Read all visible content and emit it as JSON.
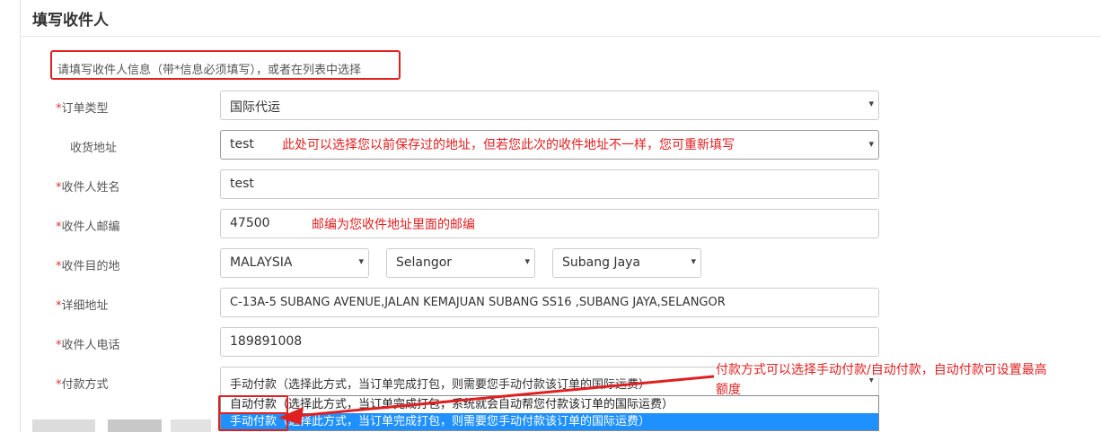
{
  "panel": {
    "title": "填写收件人"
  },
  "notice": "请填写收件人信息（带*信息必须填写），或者在列表中选择",
  "required_mark": "*",
  "fields": {
    "order_type": {
      "label": "订单类型",
      "value": "国际代运"
    },
    "address": {
      "label": "收货地址",
      "value": "test"
    },
    "name": {
      "label": "收件人姓名",
      "value": "test"
    },
    "postcode": {
      "label": "收件人邮编",
      "value": "47500"
    },
    "destination": {
      "label": "收件目的地",
      "country": "MALAYSIA",
      "state": "Selangor",
      "city": "Subang Jaya"
    },
    "detail": {
      "label": "详细地址",
      "value": "C-13A-5 SUBANG AVENUE,JALAN KEMAJUAN SUBANG SS16 ,SUBANG JAYA,SELANGOR"
    },
    "phone": {
      "label": "收件人电话",
      "value": "189891008"
    },
    "payment": {
      "label": "付款方式",
      "value": "手动付款（选择此方式，当订单完成打包，则需要您手动付款该订单的国际运费）",
      "options": [
        "自动付款（选择此方式，当订单完成打包，系统就会自动帮您付款该订单的国际运费）",
        "手动付款（选择此方式，当订单完成打包，则需要您手动付款该订单的国际运费）"
      ]
    }
  },
  "annotations": {
    "address_note": "此处可以选择您以前保存过的地址，但若您此次的收件地址不一样，您可重新填写",
    "postcode_note": "邮编为您收件地址里面的邮编",
    "payment_note_line1": "付款方式可以选择手动付款/自动付款，自动付款可设置最高",
    "payment_note_line2": "额度"
  },
  "colors": {
    "annotation": "#e02020",
    "selected_option": "#1e90ff"
  }
}
